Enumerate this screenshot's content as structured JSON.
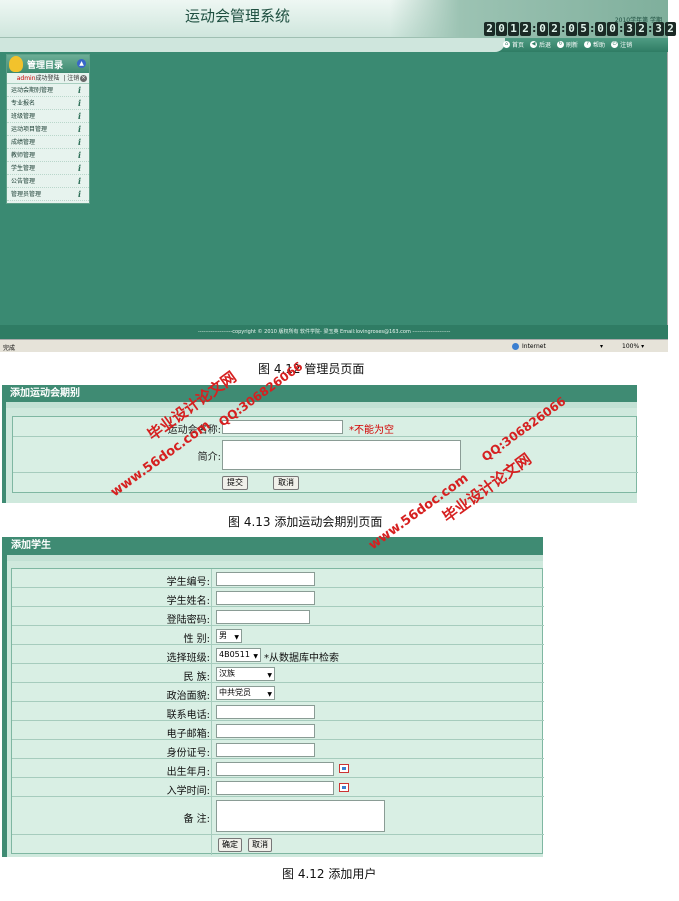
{
  "admin_page": {
    "title": "运动会管理系统",
    "term": "2010学年第 学期",
    "clock": [
      "2",
      "0",
      "1",
      "2",
      ":",
      "0",
      "2",
      ":",
      "0",
      "5",
      ":",
      "0",
      "0",
      ":",
      "3",
      "2",
      ":",
      "3",
      "2"
    ],
    "toolbar": [
      "首页",
      "后退",
      "刷新",
      "帮助",
      "注销"
    ],
    "sidebar": {
      "heading": "管理目录",
      "user": "admin",
      "login_text": "成功登陆",
      "logout": "注销",
      "items": [
        "运动会期别管理",
        "专业报名",
        "班级管理",
        "运动项目管理",
        "成绩管理",
        "教师管理",
        "学生管理",
        "公告管理",
        "管理员管理"
      ]
    },
    "copyright": "-------------------copyright © 2010 版权所有 软件学院- 梁玉英  Email:lovingroses@163.com ---------------------",
    "status": {
      "done": "完成",
      "zone": "Internet",
      "zoom": "100%"
    }
  },
  "captions": {
    "fig1": "图 4.12  管理员页面",
    "fig2": "图 4.13  添加运动会期别页面",
    "fig3": "图 4.12  添加用户"
  },
  "meet_form": {
    "heading": "添加运动会期别",
    "name_label": "运动会名称:",
    "required_note": "*不能为空",
    "intro_label": "简介:",
    "submit": "提交",
    "cancel": "取消"
  },
  "student_form": {
    "heading": "添加学生",
    "fields": {
      "student_no": "学生编号:",
      "name": "学生姓名:",
      "password": "登陆密码:",
      "gender": "性    别:",
      "class": "选择班级:",
      "ethnicity": "民    族:",
      "political": "政治面貌:",
      "phone": "联系电话:",
      "email": "电子邮箱:",
      "id_card": "身份证号:",
      "birth": "出生年月:",
      "enroll": "入学时间:",
      "remark": "备    注:"
    },
    "gender_value": "男",
    "class_value": "4B0511",
    "class_note": "*从数据库中检索",
    "ethnicity_value": "汉族",
    "political_value": "中共党员",
    "confirm": "确定",
    "cancel": "取消"
  },
  "watermarks": {
    "site": "www.56doc.com",
    "qq": "QQ:306826066",
    "name": "毕业设计论文网"
  }
}
